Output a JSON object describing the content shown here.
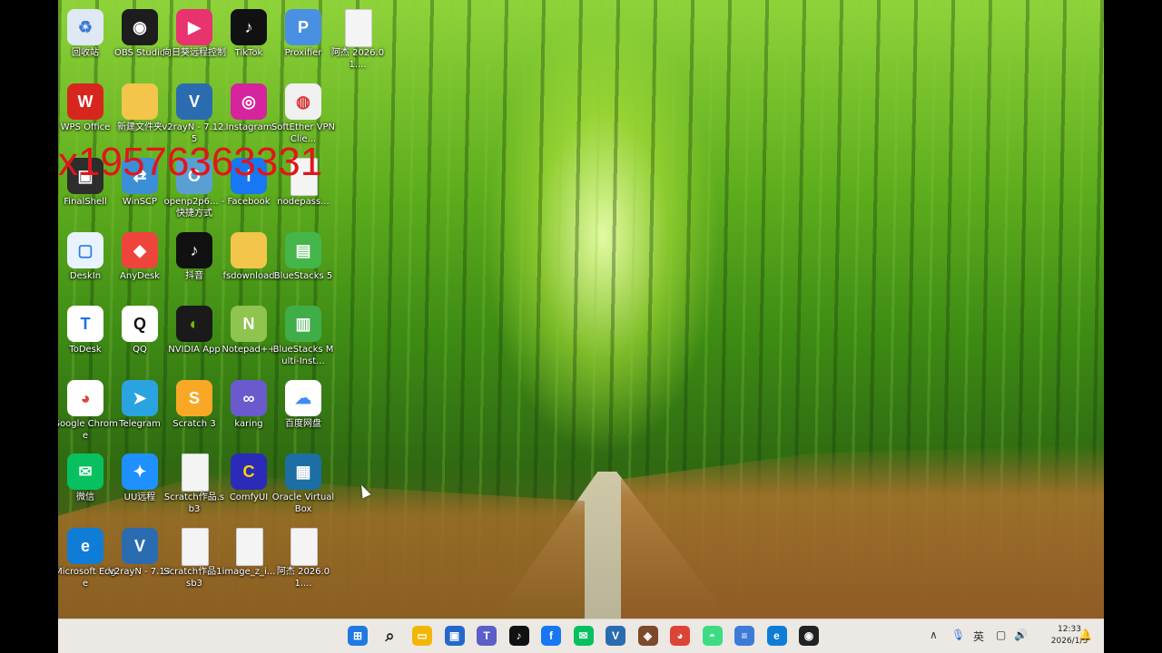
{
  "watermark": "x19576363331",
  "desktop_icons": [
    {
      "label": "回收站",
      "icon": "recycle-bin-icon"
    },
    {
      "label": "OBS Studio",
      "icon": "obs-icon"
    },
    {
      "label": "向日葵远程控制",
      "icon": "sunlogin-icon"
    },
    {
      "label": "TikTok",
      "icon": "tiktok-icon"
    },
    {
      "label": "Proxifier",
      "icon": "proxifier-icon"
    },
    {
      "label": "阿杰 2026.01....",
      "icon": "document-icon"
    },
    {
      "label": "WPS Office",
      "icon": "wps-icon"
    },
    {
      "label": "新建文件夹",
      "icon": "folder-icon"
    },
    {
      "label": "v2rayN - 7.12.5",
      "icon": "v2rayn-icon"
    },
    {
      "label": "Instagram",
      "icon": "instagram-icon"
    },
    {
      "label": "SoftEther VPN Clie...",
      "icon": "softether-icon"
    },
    {
      "label": "FinalShell",
      "icon": "finalshell-icon"
    },
    {
      "label": "WinSCP",
      "icon": "winscp-icon"
    },
    {
      "label": "openp2p6... - 快捷方式",
      "icon": "openp2p-icon"
    },
    {
      "label": "Facebook",
      "icon": "facebook-icon"
    },
    {
      "label": "nodepass...",
      "icon": "document-icon"
    },
    {
      "label": "DeskIn",
      "icon": "deskin-icon"
    },
    {
      "label": "AnyDesk",
      "icon": "anydesk-icon"
    },
    {
      "label": "抖音",
      "icon": "douyin-icon"
    },
    {
      "label": "fsdownload",
      "icon": "folder-icon"
    },
    {
      "label": "BlueStacks 5",
      "icon": "bluestacks-icon"
    },
    {
      "label": "ToDesk",
      "icon": "todesk-icon"
    },
    {
      "label": "QQ",
      "icon": "qq-icon"
    },
    {
      "label": "NVIDIA App",
      "icon": "nvidia-icon"
    },
    {
      "label": "Notepad++",
      "icon": "notepadpp-icon"
    },
    {
      "label": "BlueStacks Multi-Inst...",
      "icon": "bluestacks-multi-icon"
    },
    {
      "label": "Google Chrome",
      "icon": "chrome-icon"
    },
    {
      "label": "Telegram",
      "icon": "telegram-icon"
    },
    {
      "label": "Scratch 3",
      "icon": "scratch-icon"
    },
    {
      "label": "karing",
      "icon": "karing-icon"
    },
    {
      "label": "百度网盘",
      "icon": "baidu-netdisk-icon"
    },
    {
      "label": "微信",
      "icon": "wechat-icon"
    },
    {
      "label": "UU远程",
      "icon": "uu-remote-icon"
    },
    {
      "label": "Scratch作品.sb3",
      "icon": "document-icon"
    },
    {
      "label": "ComfyUI",
      "icon": "comfyui-icon"
    },
    {
      "label": "Oracle VirtualBox",
      "icon": "virtualbox-icon"
    },
    {
      "label": "Microsoft Edge",
      "icon": "edge-icon"
    },
    {
      "label": "v2rayN - 7.14",
      "icon": "v2rayn-icon"
    },
    {
      "label": "Scratch作品1.sb3",
      "icon": "document-icon"
    },
    {
      "label": "image_z_i...",
      "icon": "document-icon"
    },
    {
      "label": "阿杰 2026.01....",
      "icon": "document-icon"
    }
  ],
  "taskbar": {
    "apps": [
      "start-icon",
      "search-icon",
      "file-explorer-icon",
      "store-icon",
      "teams-icon",
      "tiktok-icon",
      "facebook-icon",
      "wechat-icon",
      "v2rayn-icon",
      "app-icon",
      "chrome-icon",
      "android-icon",
      "notepad-icon",
      "edge-icon",
      "obs-icon"
    ],
    "tray_language": "英",
    "clock_time": "12:33",
    "clock_date": "2026/1/3"
  }
}
